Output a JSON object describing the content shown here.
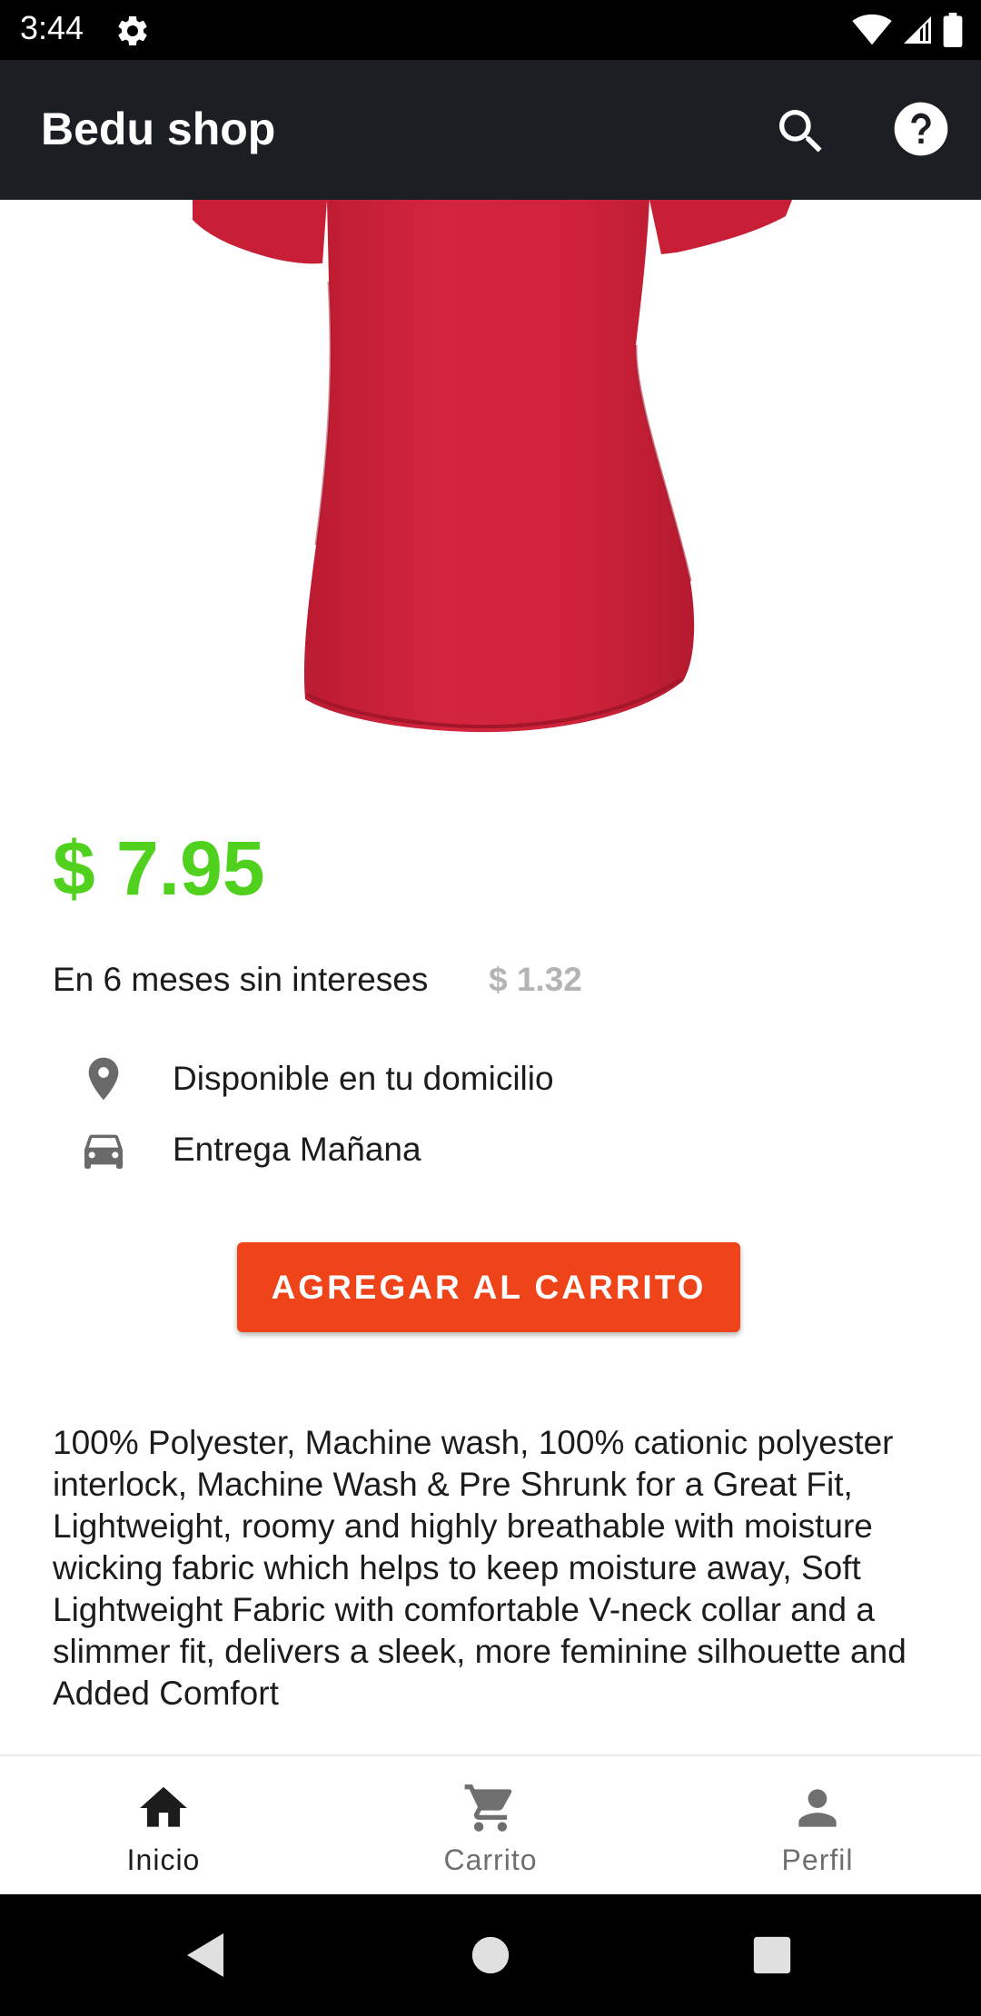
{
  "status_bar": {
    "time": "3:44"
  },
  "app_bar": {
    "title": "Bedu shop",
    "icons": [
      "search-icon",
      "help-icon"
    ]
  },
  "product": {
    "image": "red-t-shirt",
    "color": "#d0223a",
    "price": "$ 7.95",
    "installments_text": "En 6 meses sin intereses",
    "installment_amount": "$ 1.32",
    "availability": "Disponible en tu domicilio",
    "delivery": "Entrega Mañana",
    "add_to_cart_label": "AGREGAR AL CARRITO",
    "description": "100% Polyester, Machine wash, 100% cationic polyester interlock, Machine Wash & Pre Shrunk for a Great Fit, Lightweight, roomy and highly breathable with moisture wicking fabric which helps to keep moisture away, Soft Lightweight Fabric with comfortable V-neck collar and a slimmer fit, delivers a sleek, more feminine silhouette and Added Comfort"
  },
  "bottom_nav": {
    "items": [
      {
        "label": "Inicio",
        "icon": "home-icon",
        "active": true
      },
      {
        "label": "Carrito",
        "icon": "cart-icon",
        "active": false
      },
      {
        "label": "Perfil",
        "icon": "person-icon",
        "active": false
      }
    ]
  },
  "colors": {
    "price": "#4fd11d",
    "cta": "#ef4319",
    "app_bar": "#1b1f24"
  }
}
